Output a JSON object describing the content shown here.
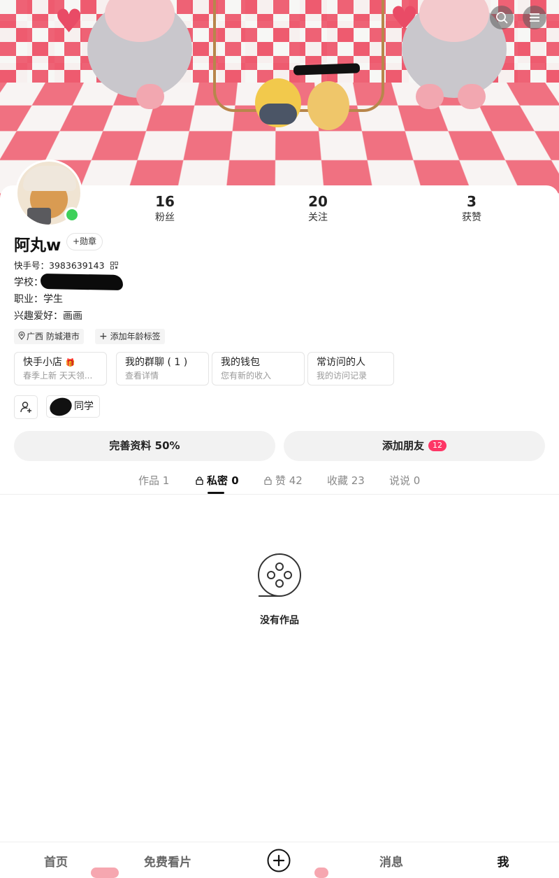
{
  "header": {
    "search_icon": "search-icon",
    "menu_icon": "menu-icon"
  },
  "profile": {
    "nickname": "阿丸w",
    "badge_button": "+勋章",
    "kuaishou_id_label": "快手号：",
    "kuaishou_id": "3983639143",
    "school_label": "学校：",
    "job_label": "职业：",
    "job_value": "学生",
    "hobby_label": "兴趣爱好：",
    "hobby_value": "画画",
    "online": true,
    "online_color": "#3ed05a"
  },
  "stats": [
    {
      "num": "16",
      "label": "粉丝"
    },
    {
      "num": "20",
      "label": "关注"
    },
    {
      "num": "3",
      "label": "获赞"
    }
  ],
  "tags": {
    "location": "广西 防城港市",
    "add_age_tag": "添加年龄标签"
  },
  "features": [
    {
      "title": "快手小店",
      "subtitle": "春季上新 天天领..."
    },
    {
      "title": "我的群聊 ( 1 )",
      "subtitle": "查看详情"
    },
    {
      "title": "我的钱包",
      "subtitle": "您有新的收入"
    },
    {
      "title": "常访问的人",
      "subtitle": "我的访问记录"
    }
  ],
  "classmate_label": "同学",
  "actions": {
    "complete_profile": "完善资料 50%",
    "add_friends": "添加朋友",
    "add_friends_count": "12",
    "badge_color": "#fe3666"
  },
  "tabs": [
    {
      "label": "作品 1"
    },
    {
      "label": "私密 0"
    },
    {
      "label": "赞 42"
    },
    {
      "label": "收藏 23"
    },
    {
      "label": "说说 0"
    }
  ],
  "empty_state": {
    "text": "没有作品"
  },
  "bottom_nav": {
    "home": "首页",
    "free": "免费看片",
    "messages": "消息",
    "me": "我"
  }
}
